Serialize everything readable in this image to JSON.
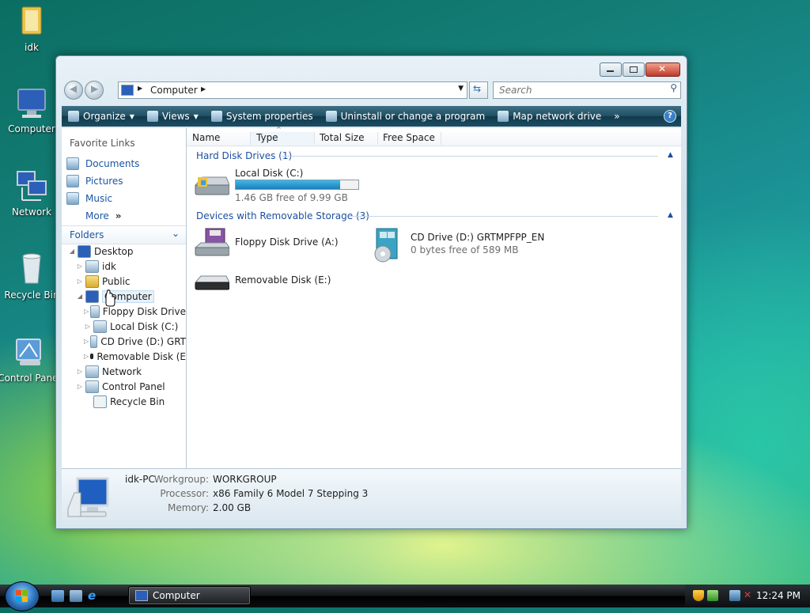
{
  "desktop": {
    "icons": [
      {
        "label": "idk"
      },
      {
        "label": "Computer"
      },
      {
        "label": "Network"
      },
      {
        "label": "Recycle Bin"
      },
      {
        "label": "Control Panel"
      }
    ]
  },
  "window": {
    "address": {
      "crumbs": [
        "Computer"
      ]
    },
    "search": {
      "placeholder": "Search"
    },
    "toolbar": {
      "items": [
        "Organize",
        "Views",
        "System properties",
        "Uninstall or change a program",
        "Map network drive"
      ],
      "overflow": "»",
      "help": "?"
    },
    "favorites": {
      "heading": "Favorite Links",
      "links": [
        "Documents",
        "Pictures",
        "Music",
        "More"
      ]
    },
    "folders": {
      "heading": "Folders",
      "tree": [
        "Desktop",
        "idk",
        "Public",
        "Computer",
        "Floppy Disk Drive",
        "Local Disk (C:)",
        "CD Drive (D:) GRT",
        "Removable Disk (E",
        "Network",
        "Control Panel",
        "Recycle Bin"
      ]
    },
    "columns": [
      "Name",
      "Type",
      "Total Size",
      "Free Space"
    ],
    "groups": {
      "hdd": {
        "title": "Hard Disk Drives (1)",
        "items": [
          {
            "name": "Local Disk (C:)",
            "free": "1.46 GB free of 9.99 GB",
            "used_fraction": 0.854
          }
        ]
      },
      "removable": {
        "title": "Devices with Removable Storage (3)",
        "items": [
          {
            "name": "Floppy Disk Drive (A:)"
          },
          {
            "name": "CD Drive (D:) GRTMPFPP_EN",
            "free": "0 bytes free of 589 MB"
          },
          {
            "name": "Removable Disk (E:)"
          }
        ]
      }
    },
    "details": {
      "computer_name": "idk-PC",
      "workgroup_label": "Workgroup:",
      "workgroup": "WORKGROUP",
      "processor_label": "Processor:",
      "processor": "x86 Family 6 Model 7 Stepping 3",
      "memory_label": "Memory:",
      "memory": "2.00 GB"
    }
  },
  "taskbar": {
    "task": "Computer",
    "clock": "12:24 PM"
  },
  "colors": {
    "link": "#1a56a5",
    "group_heading": "#1c4fa0",
    "toolbar": "#1f4f63",
    "bar_fill": "#1c7fb8"
  }
}
